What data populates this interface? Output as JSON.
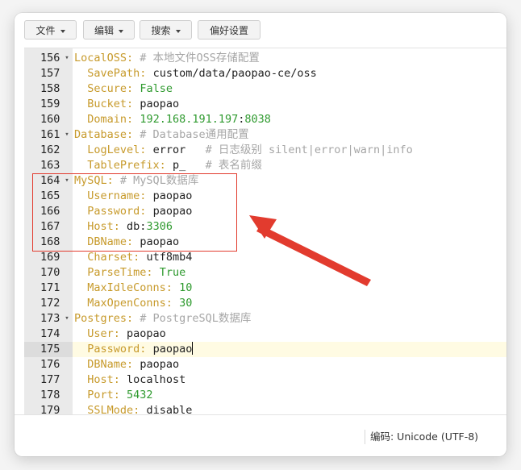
{
  "toolbar": {
    "menus": [
      {
        "label": "文件"
      },
      {
        "label": "编辑"
      },
      {
        "label": "搜索"
      }
    ],
    "preferences_label": "偏好设置"
  },
  "editor": {
    "active_line": 175,
    "lines": [
      {
        "num": "156",
        "fold": true,
        "indent": "",
        "key": "LocalOSS",
        "sep": ": ",
        "val": "",
        "vtype": "s",
        "comment": "# 本地文件OSS存储配置"
      },
      {
        "num": "157",
        "fold": false,
        "indent": "  ",
        "key": "SavePath",
        "sep": ": ",
        "val": "custom/data/paopao-ce/oss",
        "vtype": "s",
        "comment": ""
      },
      {
        "num": "158",
        "fold": false,
        "indent": "  ",
        "key": "Secure",
        "sep": ": ",
        "val": "False",
        "vtype": "b",
        "comment": ""
      },
      {
        "num": "159",
        "fold": false,
        "indent": "  ",
        "key": "Bucket",
        "sep": ": ",
        "val": "paopao",
        "vtype": "s",
        "comment": ""
      },
      {
        "num": "160",
        "fold": false,
        "indent": "  ",
        "key": "Domain",
        "sep": ": ",
        "val": "192.168.191.197",
        "vtype": "n",
        "val2": ":",
        "val3": "8038",
        "comment": ""
      },
      {
        "num": "161",
        "fold": true,
        "indent": "",
        "key": "Database",
        "sep": ": ",
        "val": "",
        "vtype": "s",
        "comment": "# Database通用配置"
      },
      {
        "num": "162",
        "fold": false,
        "indent": "  ",
        "key": "LogLevel",
        "sep": ": ",
        "val": "error",
        "vtype": "s",
        "comment": "   # 日志级别 silent|error|warn|info"
      },
      {
        "num": "163",
        "fold": false,
        "indent": "  ",
        "key": "TablePrefix",
        "sep": ": ",
        "val": "p_",
        "vtype": "s",
        "comment": "   # 表名前缀"
      },
      {
        "num": "164",
        "fold": true,
        "indent": "",
        "key": "MySQL",
        "sep": ": ",
        "val": "",
        "vtype": "s",
        "comment": "# MySQL数据库"
      },
      {
        "num": "165",
        "fold": false,
        "indent": "  ",
        "key": "Username",
        "sep": ": ",
        "val": "paopao",
        "vtype": "s",
        "comment": ""
      },
      {
        "num": "166",
        "fold": false,
        "indent": "  ",
        "key": "Password",
        "sep": ": ",
        "val": "paopao",
        "vtype": "s",
        "comment": ""
      },
      {
        "num": "167",
        "fold": false,
        "indent": "  ",
        "key": "Host",
        "sep": ": ",
        "val": "db:",
        "vtype": "s",
        "val3": "3306",
        "comment": ""
      },
      {
        "num": "168",
        "fold": false,
        "indent": "  ",
        "key": "DBName",
        "sep": ": ",
        "val": "paopao",
        "vtype": "s",
        "comment": ""
      },
      {
        "num": "169",
        "fold": false,
        "indent": "  ",
        "key": "Charset",
        "sep": ": ",
        "val": "utf8mb4",
        "vtype": "s",
        "comment": ""
      },
      {
        "num": "170",
        "fold": false,
        "indent": "  ",
        "key": "ParseTime",
        "sep": ": ",
        "val": "True",
        "vtype": "b",
        "comment": ""
      },
      {
        "num": "171",
        "fold": false,
        "indent": "  ",
        "key": "MaxIdleConns",
        "sep": ": ",
        "val": "10",
        "vtype": "n",
        "comment": ""
      },
      {
        "num": "172",
        "fold": false,
        "indent": "  ",
        "key": "MaxOpenConns",
        "sep": ": ",
        "val": "30",
        "vtype": "n",
        "comment": ""
      },
      {
        "num": "173",
        "fold": true,
        "indent": "",
        "key": "Postgres",
        "sep": ": ",
        "val": "",
        "vtype": "s",
        "comment": "# PostgreSQL数据库"
      },
      {
        "num": "174",
        "fold": false,
        "indent": "  ",
        "key": "User",
        "sep": ": ",
        "val": "paopao",
        "vtype": "s",
        "comment": ""
      },
      {
        "num": "175",
        "fold": false,
        "indent": "  ",
        "key": "Password",
        "sep": ": ",
        "val": "paopao",
        "vtype": "s",
        "comment": "",
        "cursor": true
      },
      {
        "num": "176",
        "fold": false,
        "indent": "  ",
        "key": "DBName",
        "sep": ": ",
        "val": "paopao",
        "vtype": "s",
        "comment": ""
      },
      {
        "num": "177",
        "fold": false,
        "indent": "  ",
        "key": "Host",
        "sep": ": ",
        "val": "localhost",
        "vtype": "s",
        "comment": ""
      },
      {
        "num": "178",
        "fold": false,
        "indent": "  ",
        "key": "Port",
        "sep": ": ",
        "val": "5432",
        "vtype": "n",
        "comment": ""
      },
      {
        "num": "179",
        "fold": false,
        "indent": "  ",
        "key": "SSLMode",
        "sep": ": ",
        "val": "disable",
        "vtype": "s",
        "comment": ""
      }
    ]
  },
  "statusbar": {
    "encoding": "编码: Unicode (UTF-8)"
  },
  "colors": {
    "key": "#c79a2b",
    "number": "#2f9a2f",
    "comment": "#a6a6a6",
    "annotation": "#e23b2e"
  }
}
